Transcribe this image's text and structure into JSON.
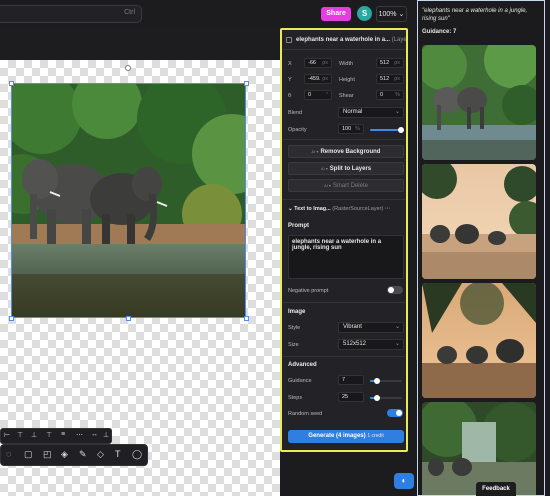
{
  "topbar": {
    "search_shortcut": "Ctrl",
    "share_label": "Share",
    "avatar_initial": "S",
    "zoom_value": "100%",
    "zoom_chevron": "⌄"
  },
  "panel": {
    "layer_title": "elephants near a waterhole in a...",
    "layer_type": "(Layer)",
    "x_label": "X",
    "x_value": "-66",
    "x_unit": "px",
    "y_label": "Y",
    "y_value": "-459.",
    "y_unit": "px",
    "rot_label": "θ",
    "rot_value": "0",
    "rot_unit": "°",
    "width_label": "Width",
    "width_value": "512",
    "width_unit": "px",
    "height_label": "Height",
    "height_value": "512",
    "height_unit": "px",
    "shear_label": "Shear",
    "shear_value": "0",
    "shear_unit": "%",
    "blend_label": "Blend",
    "blend_value": "Normal",
    "opacity_label": "Opacity",
    "opacity_value": "100",
    "opacity_unit": "%",
    "opacity_fraction": 1.0,
    "remove_bg_label": "Remove Background",
    "split_layers_label": "Split to Layers",
    "smart_delete_label": "Smart Delete",
    "button_tag": "AI ▾",
    "collapse_icon": "⌄",
    "source_title": "Text to Imag...",
    "source_type": "(RasterSourceLayer)",
    "source_menu": "···",
    "prompt_heading": "Prompt",
    "prompt_text": "elephants near a waterhole in a jungle, rising sun",
    "negative_prompt_label": "Negative prompt",
    "negative_prompt_on": false,
    "image_heading": "Image",
    "style_label": "Style",
    "style_value": "Vibrant",
    "size_label": "Size",
    "size_value": "512x512",
    "advanced_heading": "Advanced",
    "guidance_label": "Guidance",
    "guidance_value": "7",
    "steps_label": "Steps",
    "steps_value": "25",
    "random_seed_label": "Random seed",
    "random_seed_on": true,
    "generate_label": "Generate (4 images)",
    "generate_credit": "1 credit"
  },
  "gallery": {
    "prompt": "\"elephants near a waterhole in a jungle, rising sun\"",
    "guidance_text": "Guidance: 7"
  },
  "feedback_label": "Feedback",
  "help_icon": "◐",
  "colors": {
    "accent": "#2f7fe3",
    "share": "#e43de0",
    "highlight": "#ece957"
  }
}
